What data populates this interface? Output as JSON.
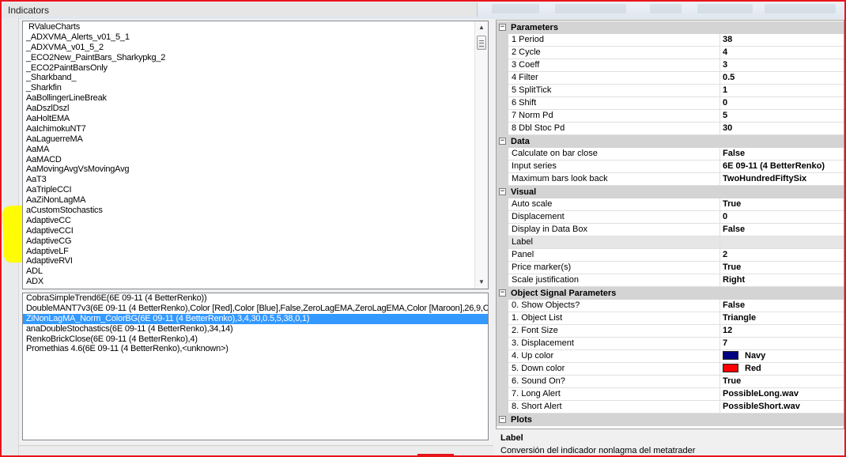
{
  "window": {
    "title": "Indicators"
  },
  "indicator_list": {
    "items": [
      "RValueCharts",
      "_ADXVMA_Alerts_v01_5_1",
      "_ADXVMA_v01_5_2",
      "_ECO2New_PaintBars_Sharkypkg_2",
      "_ECO2PaintBarsOnly",
      "_Sharkband_",
      "_Sharkfin",
      "AaBollingerLineBreak",
      "AaDszlDszl",
      "AaHoltEMA",
      "AaIchimokuNT7",
      "AaLaguerreMA",
      "AaMA",
      "AaMACD",
      "AaMovingAvgVsMovingAvg",
      "AaT3",
      "AaTripleCCI",
      "AaZiNonLagMA",
      "aCustomStochastics",
      "AdaptiveCC",
      "AdaptiveCCI",
      "AdaptiveCG",
      "AdaptiveLF",
      "AdaptiveRVI",
      "ADL",
      "ADX"
    ],
    "highlight_color": "#fffc04"
  },
  "applied_list": {
    "items": [
      "CobraSimpleTrend6E(6E 09-11 (4 BetterRenko))",
      "DoubleMANT7v3(6E 09-11 (4 BetterRenko),Color [Red],Color [Blue],False,ZeroLagEMA,ZeroLagEMA,Color [Maroon],26,9,C",
      "ZiNonLagMA_Norm_ColorBG(6E 09-11 (4 BetterRenko),3,4,30,0.5,5,38,0,1)",
      "anaDoubleStochastics(6E 09-11 (4 BetterRenko),34,14)",
      "RenkoBrickClose(6E 09-11 (4 BetterRenko),4)",
      "Promethias 4.6(6E 09-11 (4 BetterRenko),<unknown>)"
    ],
    "selected_index": 2
  },
  "properties": {
    "categories": [
      {
        "label": "Parameters",
        "rows": [
          {
            "name": "1 Period",
            "value": "38"
          },
          {
            "name": "2 Cycle",
            "value": "4"
          },
          {
            "name": "3 Coeff",
            "value": "3"
          },
          {
            "name": "4 Filter",
            "value": "0.5"
          },
          {
            "name": "5 SplitTick",
            "value": "1"
          },
          {
            "name": "6 Shift",
            "value": "0"
          },
          {
            "name": "7 Norm Pd",
            "value": "5"
          },
          {
            "name": "8 Dbl Stoc Pd",
            "value": "30"
          }
        ]
      },
      {
        "label": "Data",
        "rows": [
          {
            "name": "Calculate on bar close",
            "value": "False"
          },
          {
            "name": "Input series",
            "value": "6E 09-11 (4 BetterRenko)"
          },
          {
            "name": "Maximum bars look back",
            "value": "TwoHundredFiftySix"
          }
        ]
      },
      {
        "label": "Visual",
        "rows": [
          {
            "name": "Auto scale",
            "value": "True"
          },
          {
            "name": "Displacement",
            "value": "0"
          },
          {
            "name": "Display in Data Box",
            "value": "False"
          },
          {
            "name": "Label",
            "value": ""
          },
          {
            "name": "Panel",
            "value": "2"
          },
          {
            "name": "Price marker(s)",
            "value": "True"
          },
          {
            "name": "Scale justification",
            "value": "Right"
          }
        ]
      },
      {
        "label": "Object Signal Parameters",
        "rows": [
          {
            "name": "0. Show Objects?",
            "value": "False"
          },
          {
            "name": "1. Object List",
            "value": "Triangle"
          },
          {
            "name": "2. Font Size",
            "value": "12"
          },
          {
            "name": "3. Displacement",
            "value": "7"
          },
          {
            "name": "4. Up color",
            "value": "Navy",
            "swatch": "#000080"
          },
          {
            "name": "5. Down color",
            "value": "Red",
            "swatch": "#ff0000"
          },
          {
            "name": "6. Sound On?",
            "value": "True"
          },
          {
            "name": "7. Long Alert",
            "value": "PossibleLong.wav"
          },
          {
            "name": "8. Short Alert",
            "value": "PossibleShort.wav"
          }
        ]
      },
      {
        "label": "Plots",
        "rows": []
      }
    ],
    "toggle_glyph": "−"
  },
  "help": {
    "title": "Label",
    "text": "Conversión del indicador nonlagma del metatrader"
  },
  "colors": {
    "frame_border": "#e8141c",
    "selection": "#3399ff",
    "category_bg": "#d4d4d4"
  }
}
